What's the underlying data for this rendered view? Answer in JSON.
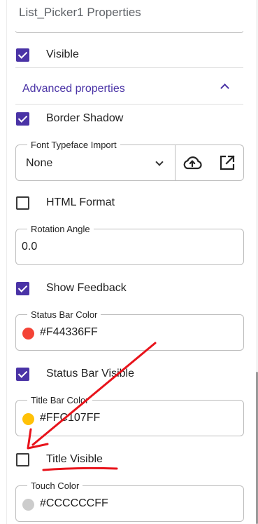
{
  "panel": {
    "title": "List_Picker1 Properties"
  },
  "visible": {
    "label": "Visible",
    "checked": true
  },
  "advanced": {
    "label": "Advanced properties"
  },
  "border_shadow": {
    "label": "Border Shadow",
    "checked": true
  },
  "font_typeface": {
    "legend": "Font Typeface Import",
    "value": "None"
  },
  "html_format": {
    "label": "HTML Format",
    "checked": false
  },
  "rotation": {
    "legend": "Rotation Angle",
    "value": "0.0"
  },
  "show_feedback": {
    "label": "Show Feedback",
    "checked": true
  },
  "status_bar_color": {
    "legend": "Status Bar Color",
    "value": "#F44336FF",
    "swatch": "#F44336"
  },
  "status_bar_visible": {
    "label": "Status Bar Visible",
    "checked": true
  },
  "title_bar_color": {
    "legend": "Title Bar Color",
    "value": "#FFC107FF",
    "swatch": "#FFC107"
  },
  "title_visible": {
    "label": "Title Visible",
    "checked": false
  },
  "touch_color": {
    "legend": "Touch Color",
    "value": "#CCCCCCFF",
    "swatch": "#CCCCCC"
  },
  "colors": {
    "accent": "#4A33A6",
    "annotation": "#E8131B"
  }
}
